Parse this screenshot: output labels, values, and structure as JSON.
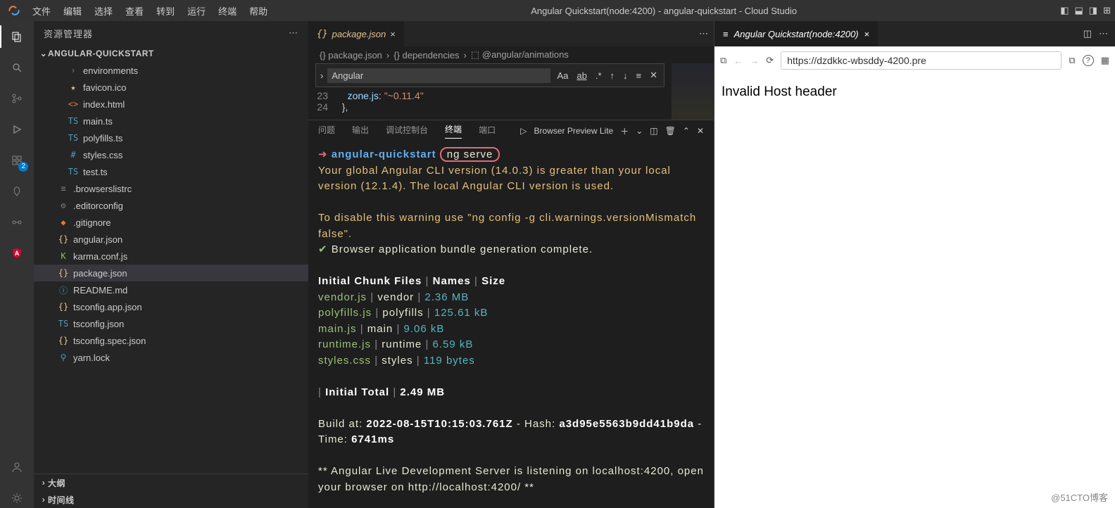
{
  "menu": [
    "文件",
    "编辑",
    "选择",
    "查看",
    "转到",
    "运行",
    "终端",
    "帮助"
  ],
  "windowTitle": "Angular Quickstart(node:4200) - angular-quickstart - Cloud Studio",
  "sidebar": {
    "title": "资源管理器",
    "folder": "ANGULAR-QUICKSTART",
    "items": [
      {
        "label": "environments",
        "icon": "›",
        "cls": "gray",
        "indent": true
      },
      {
        "label": "favicon.ico",
        "icon": "★",
        "cls": "yellow",
        "indent": true
      },
      {
        "label": "index.html",
        "icon": "<>",
        "cls": "orange",
        "indent": true
      },
      {
        "label": "main.ts",
        "icon": "TS",
        "cls": "blue",
        "indent": true
      },
      {
        "label": "polyfills.ts",
        "icon": "TS",
        "cls": "blue",
        "indent": true
      },
      {
        "label": "styles.css",
        "icon": "#",
        "cls": "blue",
        "indent": true
      },
      {
        "label": "test.ts",
        "icon": "TS",
        "cls": "blue",
        "indent": true
      },
      {
        "label": ".browserslistrc",
        "icon": "≡",
        "cls": "gray",
        "indent": false
      },
      {
        "label": ".editorconfig",
        "icon": "⚙",
        "cls": "gray",
        "indent": false
      },
      {
        "label": ".gitignore",
        "icon": "◆",
        "cls": "orange",
        "indent": false
      },
      {
        "label": "angular.json",
        "icon": "{}",
        "cls": "yellow",
        "indent": false
      },
      {
        "label": "karma.conf.js",
        "icon": "K",
        "cls": "green",
        "indent": false
      },
      {
        "label": "package.json",
        "icon": "{}",
        "cls": "yellow",
        "indent": false,
        "selected": true
      },
      {
        "label": "README.md",
        "icon": "ⓘ",
        "cls": "blue",
        "indent": false
      },
      {
        "label": "tsconfig.app.json",
        "icon": "{}",
        "cls": "yellow",
        "indent": false
      },
      {
        "label": "tsconfig.json",
        "icon": "TS",
        "cls": "blue",
        "indent": false
      },
      {
        "label": "tsconfig.spec.json",
        "icon": "{}",
        "cls": "yellow",
        "indent": false
      },
      {
        "label": "yarn.lock",
        "icon": "⚲",
        "cls": "blue",
        "indent": false
      }
    ],
    "outline": "大纲",
    "timeline": "时间线"
  },
  "tab": {
    "icon": "{}",
    "label": "package.json"
  },
  "breadcrumb": [
    "{} package.json",
    "{} dependencies",
    "⬚ @angular/animations"
  ],
  "find": {
    "value": "Angular",
    "tools": [
      "Aa",
      "ab",
      ".​*"
    ]
  },
  "code": {
    "ln1": "23",
    "t1a": "zone.js",
    "t1b": ": ",
    "t1c": "\"~0.11.4\"",
    "ln2": "24",
    "t2": "},"
  },
  "panel": {
    "tabs": [
      "问题",
      "输出",
      "调试控制台",
      "终端",
      "端口"
    ],
    "active": 3,
    "rightLabel": "Browser Preview Lite"
  },
  "terminal": {
    "arrow": "➜",
    "cwd": "angular-quickstart",
    "cmd": "ng serve",
    "warn1": "Your global Angular CLI version (14.0.3) is greater than your local version (12.1.4). The local Angular CLI version is used.",
    "warn2": "To disable this warning use \"ng config -g cli.warnings.versionMismatch false\".",
    "ok": "Browser application bundle generation complete.",
    "th1": "Initial Chunk Files",
    "th2": "Names",
    "th3": "Size",
    "rows": [
      {
        "f": "vendor.js",
        "n": "vendor",
        "s": "2.36 MB"
      },
      {
        "f": "polyfills.js",
        "n": "polyfills",
        "s": "125.61 kB"
      },
      {
        "f": "main.js",
        "n": "main",
        "s": "9.06 kB"
      },
      {
        "f": "runtime.js",
        "n": "runtime",
        "s": "6.59 kB"
      },
      {
        "f": "styles.css",
        "n": "styles",
        "s": "119 bytes"
      }
    ],
    "totalLabel": "Initial Total",
    "totalVal": "2.49 MB",
    "buildLabel": "Build at:",
    "buildTime": "2022-08-15T10:15:03.761Z",
    "hashLabel": "Hash:",
    "hash": "a3d95e5563b9dd41b9da",
    "timeLabel": "Time:",
    "time": "6741ms",
    "live": "** Angular Live Development Server is listening on localhost:4200, open your browser on http://localhost:4200/ **"
  },
  "preview": {
    "tabTitle": "Angular Quickstart(node:4200)",
    "url": "https://dzdkkc-wbsddy-4200.pre",
    "body": "Invalid Host header"
  },
  "watermark": "@51CTO博客",
  "extBadge": "2"
}
